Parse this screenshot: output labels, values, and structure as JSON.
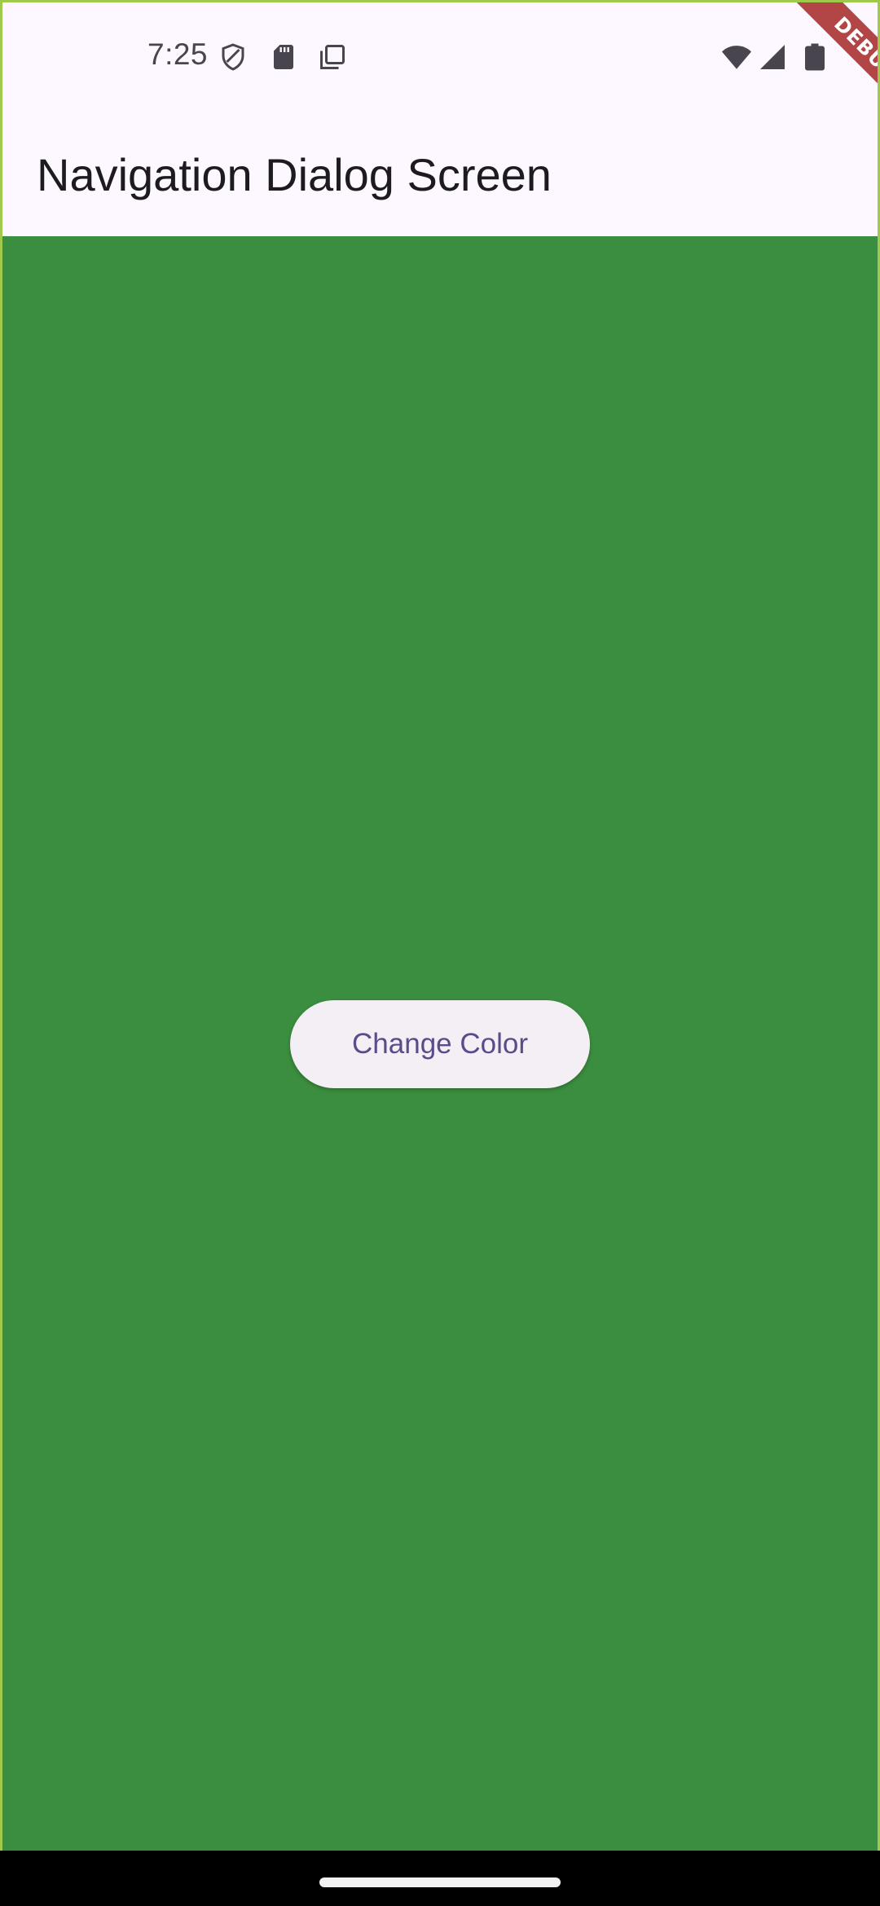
{
  "status_bar": {
    "time": "7:25",
    "left_icons": [
      "shield-icon",
      "sd-card-icon",
      "copy-icon"
    ],
    "right_icons": [
      "wifi-icon",
      "cellular-signal-icon",
      "battery-icon"
    ]
  },
  "debug_banner": {
    "label": "DEBUG",
    "color": "#a42727"
  },
  "app_bar": {
    "title": "Navigation Dialog Screen",
    "background": "#fdf7ff"
  },
  "content": {
    "background": "#3b8d3f",
    "change_color_button": {
      "label": "Change Color",
      "background": "#f4eff4",
      "text_color": "#5b4b8a"
    }
  }
}
